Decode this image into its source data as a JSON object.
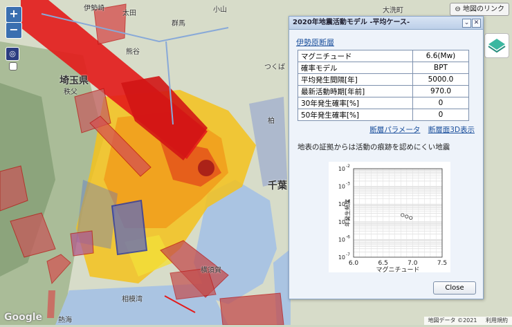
{
  "map": {
    "link_label": "地図のリンク",
    "zoom_in": "+",
    "zoom_out": "−",
    "google_label": "Google",
    "attribution_label": "地図データ ©2021",
    "terms_label": "利用規約",
    "labels": [
      "伊勢崎",
      "太田",
      "群馬",
      "小山",
      "大洗町",
      "熊谷",
      "つくば",
      "埼玉県",
      "秩父",
      "柏",
      "千葉",
      "横須賀",
      "相模湾",
      "熱海"
    ]
  },
  "dialog": {
    "title": "2020年地震活動モデル -平均ケース-",
    "fault_name": "伊勢原断層",
    "params": [
      {
        "label": "マグニチュード",
        "value": "6.6(Mw)"
      },
      {
        "label": "確率モデル",
        "value": "BPT"
      },
      {
        "label": "平均発生間隔[年]",
        "value": "5000.0"
      },
      {
        "label": "最新活動時期[年前]",
        "value": "970.0"
      },
      {
        "label": "30年発生確率[%]",
        "value": "0"
      },
      {
        "label": "50年発生確率[%]",
        "value": "0"
      }
    ],
    "link_params": "断層パラメータ",
    "link_3d": "断層面3D表示",
    "description": "地表の証拠からは活動の痕跡を認めにくい地震",
    "close_label": "Close"
  },
  "chart_data": {
    "type": "scatter",
    "xlabel": "マグニチュード",
    "ylabel": "年発生頻度",
    "xlim": [
      6.0,
      7.5
    ],
    "y_scale": "log",
    "ylim_exp": [
      -7,
      -2
    ],
    "x_ticks": [
      "6.0",
      "6.5",
      "7.0",
      "7.5"
    ],
    "y_ticks": [
      "10",
      "10",
      "10",
      "10",
      "10",
      "10"
    ],
    "y_tick_exps": [
      "-7",
      "-6",
      "-5",
      "-4",
      "-3",
      "-2"
    ],
    "points": [
      {
        "x": 6.83,
        "y_exp": -4.62
      },
      {
        "x": 6.9,
        "y_exp": -4.7
      },
      {
        "x": 6.97,
        "y_exp": -4.78
      }
    ],
    "grid": true
  }
}
